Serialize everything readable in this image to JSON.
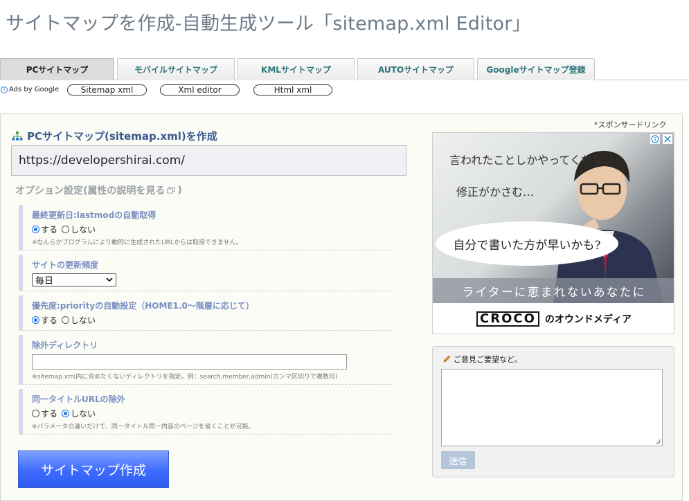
{
  "page": {
    "title": "サイトマップを作成-自動生成ツール「sitemap.xml Editor」"
  },
  "tabs": [
    {
      "label": "PCサイトマップ",
      "active": true
    },
    {
      "label": "モバイルサイトマップ",
      "active": false
    },
    {
      "label": "KMLサイトマップ",
      "active": false
    },
    {
      "label": "AUTOサイトマップ",
      "active": false
    },
    {
      "label": "Googleサイトマップ登録",
      "active": false
    }
  ],
  "ads_bar": {
    "ads_by": "Ads by Google",
    "links": [
      "Sitemap xml",
      "Xml editor",
      "Html xml"
    ]
  },
  "form": {
    "section_title": "PCサイトマップ(sitemap.xml)を作成",
    "url_value": "https://developershirai.com/",
    "options_title": "オプション設定(属性の説明を見る",
    "options_title_close": ")",
    "lastmod": {
      "label": "最終更新日:lastmodの自動取得",
      "yes": "する",
      "no": "しない",
      "selected": "yes",
      "note": "※なんらかプログラムにより動的に生成されたURLからは取得できません。"
    },
    "changefreq": {
      "label": "サイトの更新頻度",
      "selected": "毎日"
    },
    "priority": {
      "label": "優先度:priorityの自動設定（HOME1.0〜階層に応じて）",
      "yes": "する",
      "no": "しない",
      "selected": "yes"
    },
    "exclude_dir": {
      "label": "除外ディレクトリ",
      "value": "",
      "note": "※sitemap.xml内に含めたくないディレクトリを指定。例：search,member,admin(カンマ区切りで複数可)"
    },
    "same_title": {
      "label": "同一タイトルURLの除外",
      "yes": "する",
      "no": "しない",
      "selected": "no",
      "note": "※パラメータの違いだけで、同一タイトル同一内容のページを省くことが可能。"
    },
    "submit_label": "サイトマップ作成"
  },
  "sidebar": {
    "sponsor_label": "*スポンサードリンク",
    "ad": {
      "line1": "言われたことしかやってくれない…",
      "line2": "修正がかさむ…",
      "bubble": "自分で書いた方が早いかも?",
      "band": "ライターに恵まれないあなたに",
      "logo": "CROCO",
      "tagline": "のオウンドメディア"
    },
    "feedback": {
      "label": "ご意見ご要望など。",
      "value": "",
      "send_label": "送信"
    }
  }
}
